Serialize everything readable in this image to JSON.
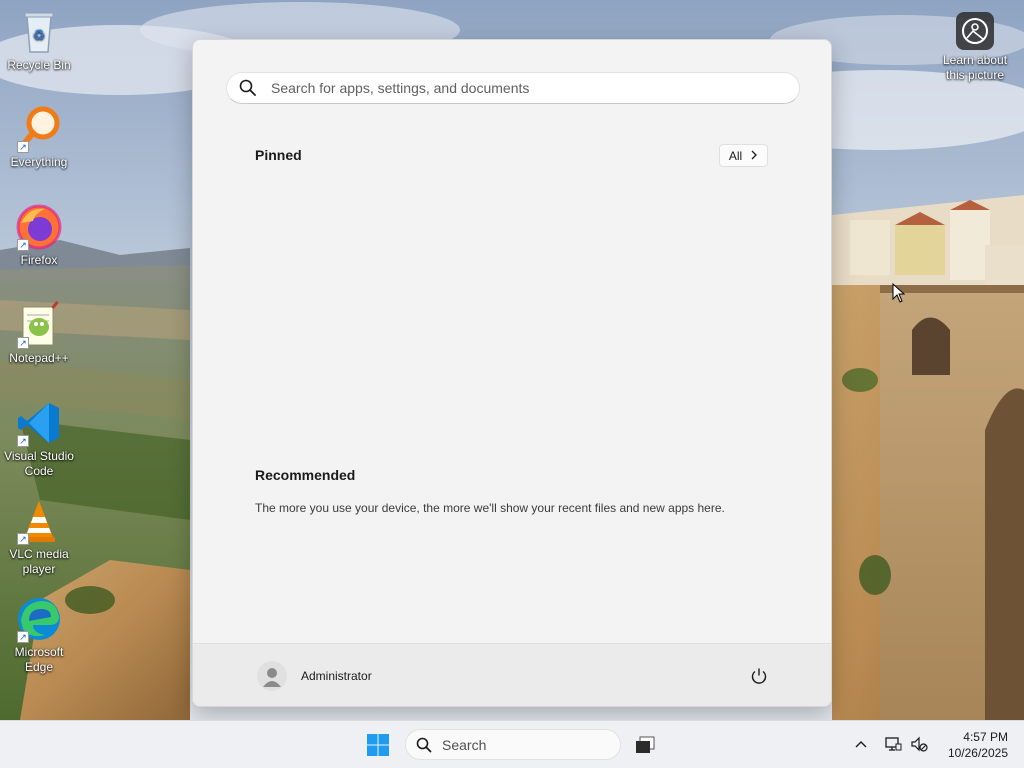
{
  "desktop": {
    "icons": [
      {
        "label": "Recycle Bin",
        "icon": "recycle-bin-icon"
      },
      {
        "label": "Everything",
        "icon": "everything-search-icon"
      },
      {
        "label": "Firefox",
        "icon": "firefox-icon"
      },
      {
        "label": "Notepad++",
        "icon": "notepad-plus-plus-icon"
      },
      {
        "label": "Visual Studio Code",
        "icon": "vscode-icon"
      },
      {
        "label": "VLC media player",
        "icon": "vlc-icon"
      },
      {
        "label": "Microsoft Edge",
        "icon": "edge-icon"
      }
    ],
    "spotlight": {
      "label": "Learn about this picture",
      "icon": "camera-spotlight-icon"
    }
  },
  "start_menu": {
    "search_placeholder": "Search for apps, settings, and documents",
    "pinned_title": "Pinned",
    "all_label": "All",
    "recommended_title": "Recommended",
    "recommended_text": "The more you use your device, the more we'll show your recent files and new apps here.",
    "user_name": "Administrator"
  },
  "taskbar": {
    "search_label": "Search",
    "time": "4:57 PM",
    "date": "10/26/2025"
  },
  "colors": {
    "accent": "#0078d4",
    "start_bg": "#f3f3f3",
    "taskbar_bg": "#eef0f3"
  }
}
